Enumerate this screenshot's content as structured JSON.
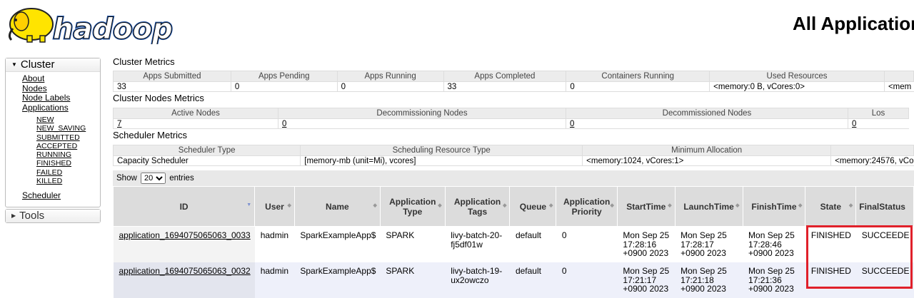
{
  "header": {
    "logo_text": "hadoop",
    "title": "All Applications"
  },
  "nav": {
    "cluster_label": "Cluster",
    "items": [
      "About",
      "Nodes",
      "Node Labels",
      "Applications"
    ],
    "app_states": [
      "NEW",
      "NEW_SAVING",
      "SUBMITTED",
      "ACCEPTED",
      "RUNNING",
      "FINISHED",
      "FAILED",
      "KILLED"
    ],
    "scheduler": "Scheduler",
    "tools_label": "Tools"
  },
  "cluster_metrics": {
    "title": "Cluster Metrics",
    "headers": [
      "Apps Submitted",
      "Apps Pending",
      "Apps Running",
      "Apps Completed",
      "Containers Running",
      "Used Resources",
      ""
    ],
    "values": [
      "33",
      "0",
      "0",
      "33",
      "0",
      "<memory:0 B, vCores:0>",
      "<mem"
    ]
  },
  "node_metrics": {
    "title": "Cluster Nodes Metrics",
    "headers": [
      "Active Nodes",
      "Decommissioning Nodes",
      "Decommissioned Nodes",
      "Los"
    ],
    "values": [
      "7",
      "0",
      "0",
      "0"
    ]
  },
  "scheduler_metrics": {
    "title": "Scheduler Metrics",
    "headers": [
      "Scheduler Type",
      "Scheduling Resource Type",
      "Minimum Allocation",
      ""
    ],
    "values": [
      "Capacity Scheduler",
      "[memory-mb (unit=Mi), vcores]",
      "<memory:1024, vCores:1>",
      "<memory:24576, vCo"
    ]
  },
  "apps": {
    "show_label": "Show",
    "entries_value": "20",
    "entries_label": "entries",
    "columns": [
      "ID",
      "User",
      "Name",
      "Application Type",
      "Application Tags",
      "Queue",
      "Application Priority",
      "StartTime",
      "LaunchTime",
      "FinishTime",
      "State",
      "FinalStatus"
    ],
    "rows": [
      {
        "id": "application_1694075065063_0033",
        "user": "hadmin",
        "name": "SparkExampleApp$",
        "type": "SPARK",
        "tags": "livy-batch-20-fj5df01w",
        "queue": "default",
        "priority": "0",
        "start": "Mon Sep 25 17:28:16 +0900 2023",
        "launch": "Mon Sep 25 17:28:17 +0900 2023",
        "finish": "Mon Sep 25 17:28:46 +0900 2023",
        "state": "FINISHED",
        "final": "SUCCEEDE"
      },
      {
        "id": "application_1694075065063_0032",
        "user": "hadmin",
        "name": "SparkExampleApp$",
        "type": "SPARK",
        "tags": "livy-batch-19-ux2owczo",
        "queue": "default",
        "priority": "0",
        "start": "Mon Sep 25 17:21:17 +0900 2023",
        "launch": "Mon Sep 25 17:21:18 +0900 2023",
        "finish": "Mon Sep 25 17:21:36 +0900 2023",
        "state": "FINISHED",
        "final": "SUCCEEDE"
      }
    ]
  },
  "colors": {
    "highlight": "#e0202a",
    "logo_blue": "#1a4fa3",
    "logo_yellow": "#ffe400"
  }
}
